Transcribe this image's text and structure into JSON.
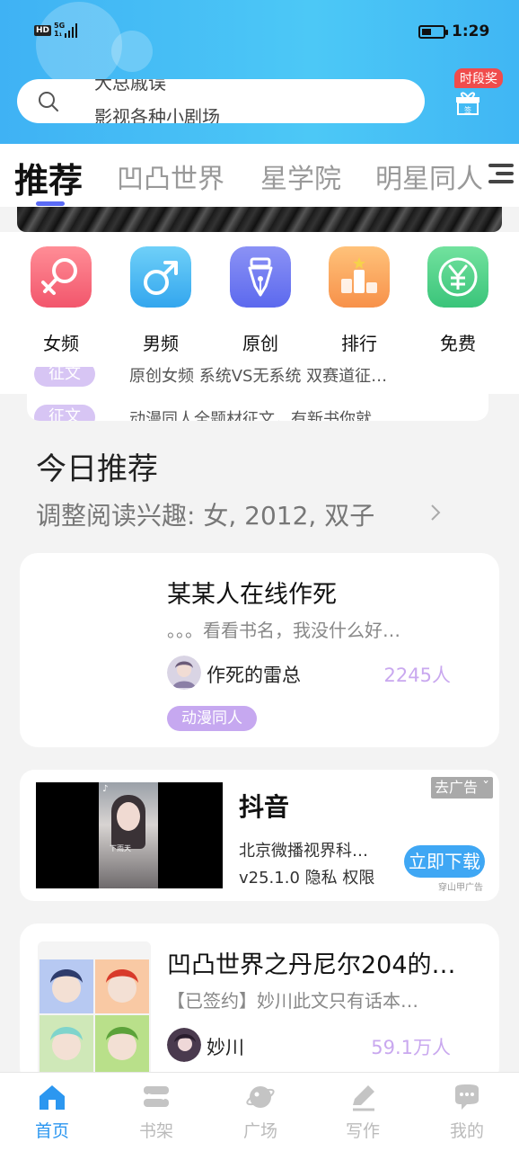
{
  "status_bar": {
    "network_hd": "HD",
    "network_gen": "5G",
    "network_sub": "1₁",
    "time": "1:29"
  },
  "search": {
    "placeholder_old": "大总戚误",
    "placeholder": "影视各种小剧场"
  },
  "gift": {
    "badge": "时段奖",
    "sign_label": "签"
  },
  "tabs": [
    {
      "label": "推荐",
      "active": true
    },
    {
      "label": "凹凸世界"
    },
    {
      "label": "星学院"
    },
    {
      "label": "明星同人"
    }
  ],
  "categories": [
    {
      "label": "女频",
      "icon": "female-icon",
      "color": "#f76b7a"
    },
    {
      "label": "男频",
      "icon": "male-icon",
      "color": "#48b8f2"
    },
    {
      "label": "原创",
      "icon": "pen-icon",
      "color": "#6f7cf0"
    },
    {
      "label": "排行",
      "icon": "ranking-icon",
      "color": "#f9a35c"
    },
    {
      "label": "免费",
      "icon": "yuan-icon",
      "color": "#4ed48a"
    }
  ],
  "notices": [
    {
      "tag": "征文",
      "text": "原创女频  系统VS无系统  双赛道征…"
    },
    {
      "tag": "征文",
      "text": "动漫同人全题材征文，有新书你就…"
    }
  ],
  "today": {
    "title": "今日推荐",
    "subtitle": "调整阅读兴趣: 女, 2012, 双子"
  },
  "books": [
    {
      "title": "某某人在线作死",
      "desc": "。。。看看书名，我没什么好…",
      "author": "作死的雷总",
      "readers": "2245人",
      "tag": "动漫同人"
    },
    {
      "title": "凹凸世界之丹尼尔204的…",
      "desc": "【已签约】妙川此文只有话本…",
      "author": "妙川",
      "readers": "59.1万人"
    }
  ],
  "ad": {
    "app_name": "抖音",
    "company": "北京微播视界科…",
    "version_line": "v25.1.0 隐私  权限",
    "close_label": "去广告 ˇ",
    "download_label": "立即下载",
    "source": "穿山甲广告",
    "video_caption": "下雨天",
    "video_logo": "♪"
  },
  "bottom_nav": [
    {
      "label": "首页",
      "icon": "home-icon",
      "active": true
    },
    {
      "label": "书架",
      "icon": "bookshelf-icon"
    },
    {
      "label": "广场",
      "icon": "planet-icon"
    },
    {
      "label": "写作",
      "icon": "pencil-icon"
    },
    {
      "label": "我的",
      "icon": "chat-bubble-icon"
    }
  ],
  "colors": {
    "accent": "#2c97f0",
    "header": "#45bdf5",
    "tag_purple": "#c6a8f0"
  }
}
